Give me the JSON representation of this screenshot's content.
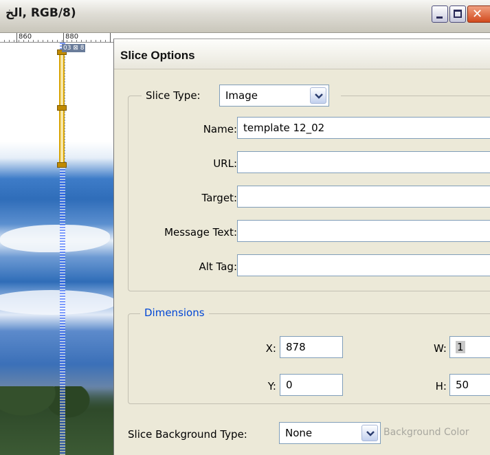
{
  "document_window": {
    "title": "الخ, RGB/8)",
    "ruler_labels": [
      "860",
      "880"
    ]
  },
  "canvas": {
    "slice_badge": "03 ⊠ 8"
  },
  "dialog": {
    "title": "Slice Options",
    "slice_type": {
      "label": "Slice Type:",
      "value": "Image"
    },
    "fields": {
      "name": {
        "label": "Name:",
        "value": "template 12_02"
      },
      "url": {
        "label": "URL:",
        "value": ""
      },
      "target": {
        "label": "Target:",
        "value": ""
      },
      "message": {
        "label": "Message Text:",
        "value": ""
      },
      "alt": {
        "label": "Alt Tag:",
        "value": ""
      }
    },
    "dimensions": {
      "legend": "Dimensions",
      "x": {
        "label": "X:",
        "value": "878"
      },
      "y": {
        "label": "Y:",
        "value": "0"
      },
      "w": {
        "label": "W:",
        "value": "1"
      },
      "h": {
        "label": "H:",
        "value": "50"
      }
    },
    "background": {
      "label": "Slice Background Type:",
      "value": "None",
      "color_label": "Background Color"
    }
  },
  "colors": {
    "dialog_bg": "#ece9d8",
    "dimensions_legend": "#0046d5",
    "field_border": "#7f9db9",
    "slice_selected": "#d8a300"
  }
}
